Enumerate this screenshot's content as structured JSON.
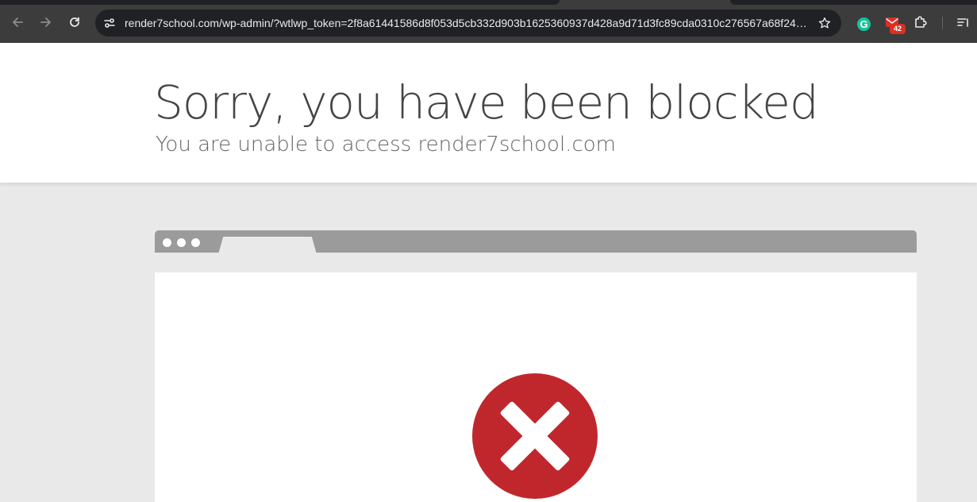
{
  "browser": {
    "url": "render7school.com/wp-admin/?wtlwp_token=2f8a61441586d8f053d5cb332d903b1625360937d428a9d71d3fc89cda0310c276567a68f240...",
    "extensions": {
      "grammarly_letter": "G",
      "mail_badge_count": "42"
    }
  },
  "page": {
    "title": "Sorry, you have been blocked",
    "subtitle": "You are unable to access render7school.com"
  },
  "colors": {
    "toolbar_bg": "#3c3c3c",
    "omnibox_bg": "#202124",
    "error_red": "#c0272d",
    "page_bg": "#e9e9e9"
  }
}
